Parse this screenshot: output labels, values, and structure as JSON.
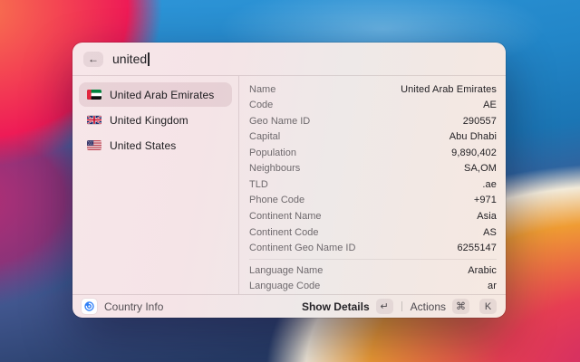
{
  "window": {
    "search": {
      "back_icon": "←",
      "value": "united"
    },
    "list": {
      "items": [
        {
          "name": "United Arab Emirates",
          "flag": "ae",
          "selected": true
        },
        {
          "name": "United Kingdom",
          "flag": "gb",
          "selected": false
        },
        {
          "name": "United States",
          "flag": "us",
          "selected": false
        }
      ]
    },
    "details": {
      "groups": [
        {
          "rows": [
            {
              "label": "Name",
              "value": "United Arab Emirates"
            },
            {
              "label": "Code",
              "value": "AE"
            },
            {
              "label": "Geo Name ID",
              "value": "290557"
            },
            {
              "label": "Capital",
              "value": "Abu Dhabi"
            },
            {
              "label": "Population",
              "value": "9,890,402"
            },
            {
              "label": "Neighbours",
              "value": "SA,OM"
            },
            {
              "label": "TLD",
              "value": ".ae"
            },
            {
              "label": "Phone Code",
              "value": "+971"
            },
            {
              "label": "Continent Name",
              "value": "Asia"
            },
            {
              "label": "Continent Code",
              "value": "AS"
            },
            {
              "label": "Continent Geo Name ID",
              "value": "6255147"
            }
          ]
        },
        {
          "rows": [
            {
              "label": "Language Name",
              "value": "Arabic"
            },
            {
              "label": "Language Code",
              "value": "ar"
            }
          ]
        }
      ]
    },
    "footer": {
      "app_name": "Country Info",
      "primary_action": "Show Details",
      "primary_key": "↵",
      "secondary_action": "Actions",
      "secondary_keys": [
        "⌘",
        "K"
      ]
    }
  },
  "colors": {
    "accent_blue": "#2f7ff7",
    "selection": "rgba(146,92,105,0.14)"
  }
}
